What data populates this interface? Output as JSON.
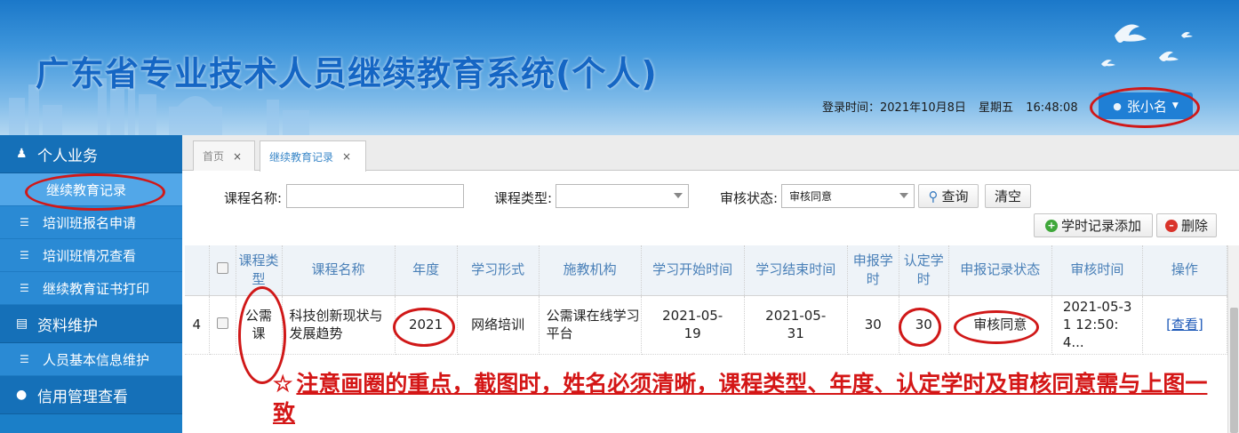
{
  "header": {
    "title": "广东省专业技术人员继续教育系统(个人)",
    "login_label": "登录时间：2021年10月8日",
    "weekday": "星期五",
    "time": "16:48:08",
    "user_name": "张小名"
  },
  "sidebar": {
    "groups": [
      {
        "label": "个人业务",
        "icon": "person-icon",
        "items": [
          {
            "label": "继续教育记录",
            "active": true
          },
          {
            "label": "培训班报名申请"
          },
          {
            "label": "培训班情况查看"
          },
          {
            "label": "继续教育证书打印"
          }
        ]
      },
      {
        "label": "资料维护",
        "icon": "book-icon",
        "items": [
          {
            "label": "人员基本信息维护"
          }
        ]
      },
      {
        "label": "信用管理查看",
        "icon": "pin-icon",
        "items": []
      }
    ]
  },
  "tabs": [
    {
      "label": "首页",
      "close": "×"
    },
    {
      "label": "继续教育记录",
      "close": "×",
      "active": true
    }
  ],
  "search": {
    "course_name_label": "课程名称:",
    "course_name_value": "",
    "course_type_label": "课程类型:",
    "course_type_value": "",
    "review_status_label": "审核状态:",
    "review_status_value": "审核同意",
    "query_button": "查询",
    "clear_button": "清空"
  },
  "actions": {
    "add_button": "学时记录添加",
    "delete_button": "删除"
  },
  "table": {
    "headers": [
      "",
      "",
      "课程类型",
      "课程名称",
      "年度",
      "学习形式",
      "施教机构",
      "学习开始时间",
      "学习结束时间",
      "申报学时",
      "认定学时",
      "申报记录状态",
      "审核时间",
      "操作"
    ],
    "rows": [
      {
        "index": "4",
        "course_type": "公需课",
        "course_name": "科技创新现状与发展趋势",
        "year": "2021",
        "form": "网络培训",
        "institution": "公需课在线学习平台",
        "start": "2021-05-19",
        "end": "2021-05-31",
        "declared_hours": "30",
        "approved_hours": "30",
        "status": "审核同意",
        "review_time": "2021-05-31 12:50:4...",
        "action": "[查看]"
      }
    ]
  },
  "note": {
    "icon": "☆",
    "text": "注意画圈的重点，截图时，姓名必须清晰，课程类型、年度、认定学时及审核同意需与上图一致"
  },
  "colors": {
    "header_blue": "#1b78c9",
    "sidebar_blue": "#1b7fc8",
    "annotation_red": "#d01818",
    "link_blue": "#1c58b8"
  }
}
